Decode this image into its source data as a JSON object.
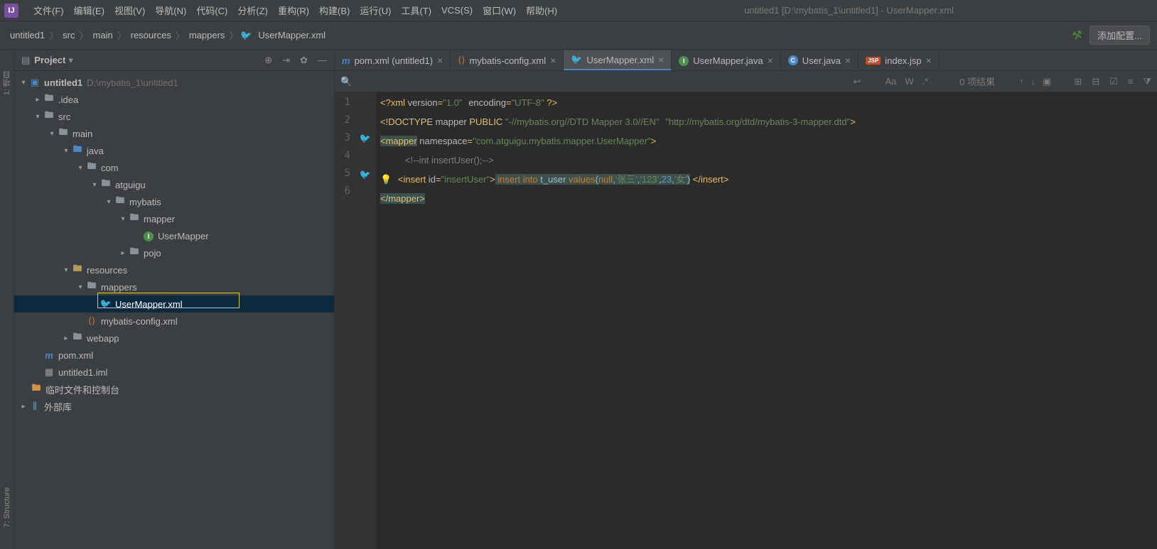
{
  "window_title": "untitled1 [D:\\mybatis_1\\untitled1] - UserMapper.xml",
  "menu": [
    "文件(F)",
    "编辑(E)",
    "视图(V)",
    "导航(N)",
    "代码(C)",
    "分析(Z)",
    "重构(R)",
    "构建(B)",
    "运行(U)",
    "工具(T)",
    "VCS(S)",
    "窗口(W)",
    "帮助(H)"
  ],
  "add_config": "添加配置...",
  "breadcrumbs": [
    "untitled1",
    "src",
    "main",
    "resources",
    "mappers",
    "UserMapper.xml"
  ],
  "leftrail_top": "1: 项目",
  "leftrail_bottom": "7: Structure",
  "project_title": "Project",
  "tree": {
    "root": {
      "name": "untitled1",
      "hint": "D:\\mybatis_1\\untitled1"
    },
    "idea": ".idea",
    "src": "src",
    "main": "main",
    "java": "java",
    "com": "com",
    "atguigu": "atguigu",
    "mybatis": "mybatis",
    "mapper": "mapper",
    "usermapper_iface": "UserMapper",
    "pojo": "pojo",
    "resources": "resources",
    "mappers": "mappers",
    "usermapper_xml": "UserMapper.xml",
    "mybatis_cfg": "mybatis-config.xml",
    "webapp": "webapp",
    "pom": "pom.xml",
    "iml": "untitled1.iml",
    "scratch": "临时文件和控制台",
    "extlib": "外部库"
  },
  "tabs": [
    {
      "label": "pom.xml (untitled1)",
      "icon": "m"
    },
    {
      "label": "mybatis-config.xml",
      "icon": "xml"
    },
    {
      "label": "UserMapper.xml",
      "icon": "bird",
      "active": true
    },
    {
      "label": "UserMapper.java",
      "icon": "iface"
    },
    {
      "label": "User.java",
      "icon": "class"
    },
    {
      "label": "index.jsp",
      "icon": "jsp"
    }
  ],
  "find_results": "0 项结果",
  "code": {
    "l1_pre": "<?xml ",
    "l1_attr1": "version",
    "l1_v1": "\"1.0\"",
    "l1_attr2": "encoding",
    "l1_v2": "\"UTF-8\"",
    "l1_post": " ?>",
    "l2_pre": "<!DOCTYPE ",
    "l2_name": "mapper",
    "l2_pub": " PUBLIC ",
    "l2_s1": "\"-//mybatis.org//DTD Mapper 3.0//EN\"",
    "l2_s2": "\"http://mybatis.org/dtd/mybatis-3-mapper.dtd\"",
    "l3_tag": "<mapper",
    "l3_sp": " ",
    "l3_attr": "namespace",
    "l3_val": "\"com.atguigu.mybatis.mapper.UserMapper\"",
    "l3_end": ">",
    "l4": "<!--int insertUser();-->",
    "l5_pre": "<insert ",
    "l5_attr": "id",
    "l5_val": "\"insertUser\"",
    "l5_close": ">",
    "l5_sql_ins": "insert ",
    "l5_sql_into": "into ",
    "l5_tbl": "t_user ",
    "l5_vals": "values",
    "l5_paren": "(",
    "l5_null": "null",
    "l5_c1": ",",
    "l5_s1": "'张三'",
    "l5_c2": ",",
    "l5_s2": "'123'",
    "l5_c3": ",",
    "l5_n1": "23",
    "l5_c4": ",",
    "l5_s3": "'女'",
    "l5_paren2": ")",
    "l5_sp": " ",
    "l5_endtag": "</insert>",
    "l6": "</mapper>"
  }
}
